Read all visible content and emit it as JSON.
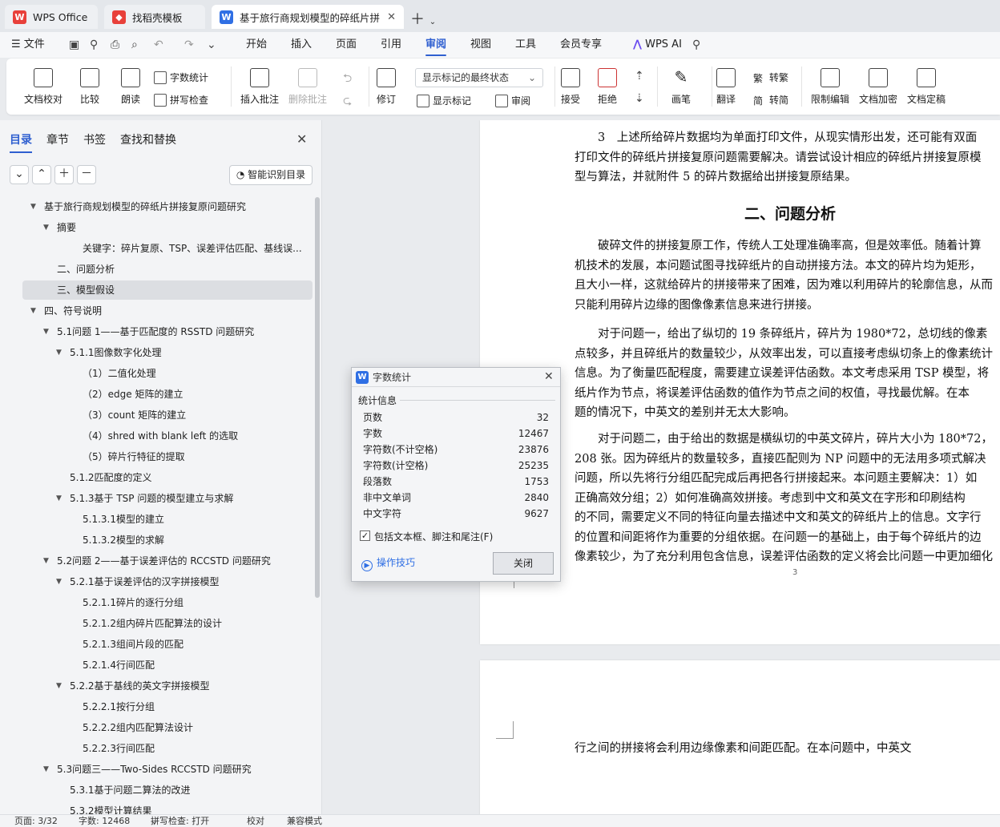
{
  "tabs": [
    {
      "label": "WPS Office",
      "icon": "wps-logo-icon"
    },
    {
      "label": "找稻壳模板",
      "icon": "daoke-icon"
    },
    {
      "label": "基于旅行商规划模型的碎纸片拼",
      "icon": "writer-doc-icon"
    }
  ],
  "menu": {
    "file": "文件",
    "items": [
      "开始",
      "插入",
      "页面",
      "引用",
      "审阅",
      "视图",
      "工具",
      "会员专享"
    ],
    "active": "审阅",
    "wps_ai": "WPS AI"
  },
  "ribbon": {
    "doc_check": "文档校对",
    "compare": "比较",
    "read_aloud": "朗读",
    "word_count": "字数统计",
    "spell_check": "拼写检查",
    "insert_comment": "插入批注",
    "delete_comment": "删除批注",
    "revise": "修订",
    "markup_state": "显示标记的最终状态",
    "show_markup": "显示标记",
    "review": "审阅",
    "accept": "接受",
    "reject": "拒绝",
    "pen": "画笔",
    "translate": "翻译",
    "to_traditional": "转繁",
    "to_simplified": "转简",
    "restrict_edit": "限制编辑",
    "encrypt": "文档加密",
    "finalize": "文档定稿"
  },
  "nav": {
    "tabs": [
      "目录",
      "章节",
      "书签",
      "查找和替换"
    ],
    "smart_button": "智能识别目录",
    "toc": [
      {
        "label": "基于旅行商规划模型的碎纸片拼接复原问题研究",
        "level": 0,
        "arrow": true
      },
      {
        "label": "摘要",
        "level": 1,
        "arrow": true
      },
      {
        "label": "关键字：碎片复原、TSP、误差评估匹配、基线误...",
        "level": 3,
        "arrow": false
      },
      {
        "label": "二、问题分析",
        "level": 1,
        "arrow": false
      },
      {
        "label": "三、模型假设",
        "level": 1,
        "arrow": false,
        "selected": true
      },
      {
        "label": "四、符号说明",
        "level": 0,
        "arrow": true
      },
      {
        "label": "5.1问题 1——基于匹配度的 RSSTD 问题研究",
        "level": 1,
        "arrow": true
      },
      {
        "label": "5.1.1图像数字化处理",
        "level": 2,
        "arrow": true
      },
      {
        "label": "（1）二值化处理",
        "level": 3,
        "arrow": false
      },
      {
        "label": "（2）edge 矩阵的建立",
        "level": 3,
        "arrow": false
      },
      {
        "label": "（3）count 矩阵的建立",
        "level": 3,
        "arrow": false
      },
      {
        "label": "（4）shred with blank left 的选取",
        "level": 3,
        "arrow": false
      },
      {
        "label": "（5）碎片行特征的提取",
        "level": 3,
        "arrow": false
      },
      {
        "label": "5.1.2匹配度的定义",
        "level": 2,
        "arrow": false
      },
      {
        "label": "5.1.3基于 TSP 问题的模型建立与求解",
        "level": 2,
        "arrow": true
      },
      {
        "label": "5.1.3.1模型的建立",
        "level": 3,
        "arrow": false
      },
      {
        "label": "5.1.3.2模型的求解",
        "level": 3,
        "arrow": false
      },
      {
        "label": "5.2问题 2——基于误差评估的 RCCSTD 问题研究",
        "level": 1,
        "arrow": true
      },
      {
        "label": "5.2.1基于误差评估的汉字拼接模型",
        "level": 2,
        "arrow": true
      },
      {
        "label": "5.2.1.1碎片的逐行分组",
        "level": 3,
        "arrow": false
      },
      {
        "label": "5.2.1.2组内碎片匹配算法的设计",
        "level": 3,
        "arrow": false
      },
      {
        "label": "5.2.1.3组间片段的匹配",
        "level": 3,
        "arrow": false
      },
      {
        "label": "5.2.1.4行间匹配",
        "level": 3,
        "arrow": false
      },
      {
        "label": "5.2.2基于基线的英文字拼接模型",
        "level": 2,
        "arrow": true
      },
      {
        "label": "5.2.2.1按行分组",
        "level": 3,
        "arrow": false
      },
      {
        "label": "5.2.2.2组内匹配算法设计",
        "level": 3,
        "arrow": false
      },
      {
        "label": "5.2.2.3行间匹配",
        "level": 3,
        "arrow": false
      },
      {
        "label": "5.3问题三——Two-Sides RCCSTD 问题研究",
        "level": 1,
        "arrow": true
      },
      {
        "label": "5.3.1基于问题二算法的改进",
        "level": 2,
        "arrow": false
      },
      {
        "label": "5.3.2模型计算结果",
        "level": 2,
        "arrow": false
      }
    ]
  },
  "document": {
    "lines": [
      "　　3　上述所给碎片数据均为单面打印文件，从现实情形出发，还可能有双面",
      "打印文件的碎纸片拼接复原问题需要解决。请尝试设计相应的碎纸片拼接复原模",
      "型与算法，并就附件 5 的碎片数据给出拼接复原结果。"
    ],
    "heading": "二、问题分析",
    "para1": [
      "　　破碎文件的拼接复原工作，传统人工处理准确率高，但是效率低。随着计算",
      "机技术的发展，本问题试图寻找碎纸片的自动拼接方法。本文的碎片均为矩形，",
      "且大小一样，这就给碎片的拼接带来了困难，因为难以利用碎片的轮廓信息，从而",
      "只能利用碎片边缘的图像像素信息来进行拼接。"
    ],
    "para2": [
      "　　对于问题一，给出了纵切的 19 条碎纸片，碎片为 1980*72，总切线的像素",
      "点较多，并且碎纸片的数量较少，从效率出发，可以直接考虑纵切条上的像素统计",
      "信息。为了衡量匹配程度，需要建立误差评估函数。本文考虑采用 TSP 模型，将",
      "纸片作为节点，将误差评估函数的值作为节点之间的权值，寻找最优解。在本",
      "题的情况下，中英文的差别并无太大影响。"
    ],
    "para3": [
      "　　对于问题二，由于给出的数据是横纵切的中英文碎片，碎片大小为 180*72，",
      "208 张。因为碎纸片的数量较多，直接匹配则为 NP 问题中的无法用多项式解决",
      "问题，所以先将行分组匹配完成后再把各行拼接起来。本问题主要解决：1）如",
      "正确高效分组；2）如何准确高效拼接。考虑到中文和英文在字形和印刷结构",
      "的不同，需要定义不同的特征向量去描述中文和英文的碎纸片上的信息。文字行",
      "的位置和间距将作为重要的分组依据。在问题一的基础上，由于每个碎纸片的边",
      "像素较少，为了充分利用包含信息，误差评估函数的定义将会比问题一中更加细化"
    ],
    "page_number": "3",
    "page2_line": "行之间的拼接将会利用边缘像素和间距匹配。在本问题中，中英文"
  },
  "dialog": {
    "title": "字数统计",
    "section": "统计信息",
    "stats": [
      {
        "label": "页数",
        "value": "32"
      },
      {
        "label": "字数",
        "value": "12467"
      },
      {
        "label": "字符数(不计空格)",
        "value": "23876"
      },
      {
        "label": "字符数(计空格)",
        "value": "25235"
      },
      {
        "label": "段落数",
        "value": "1753"
      },
      {
        "label": "非中文单词",
        "value": "2840"
      },
      {
        "label": "中文字符",
        "value": "9627"
      }
    ],
    "include_label": "包括文本框、脚注和尾注(F)",
    "include_checked": true,
    "tips": "操作技巧",
    "close": "关闭"
  },
  "status": {
    "page": "页面: 3/32",
    "words": "字数: 12468",
    "spell": "拼写检查: 打开",
    "proof": "校对",
    "compat": "兼容模式"
  },
  "colors": {
    "accent": "#2f5fd0",
    "wps_red": "#e8403a",
    "writer_blue": "#2f6fe4"
  }
}
